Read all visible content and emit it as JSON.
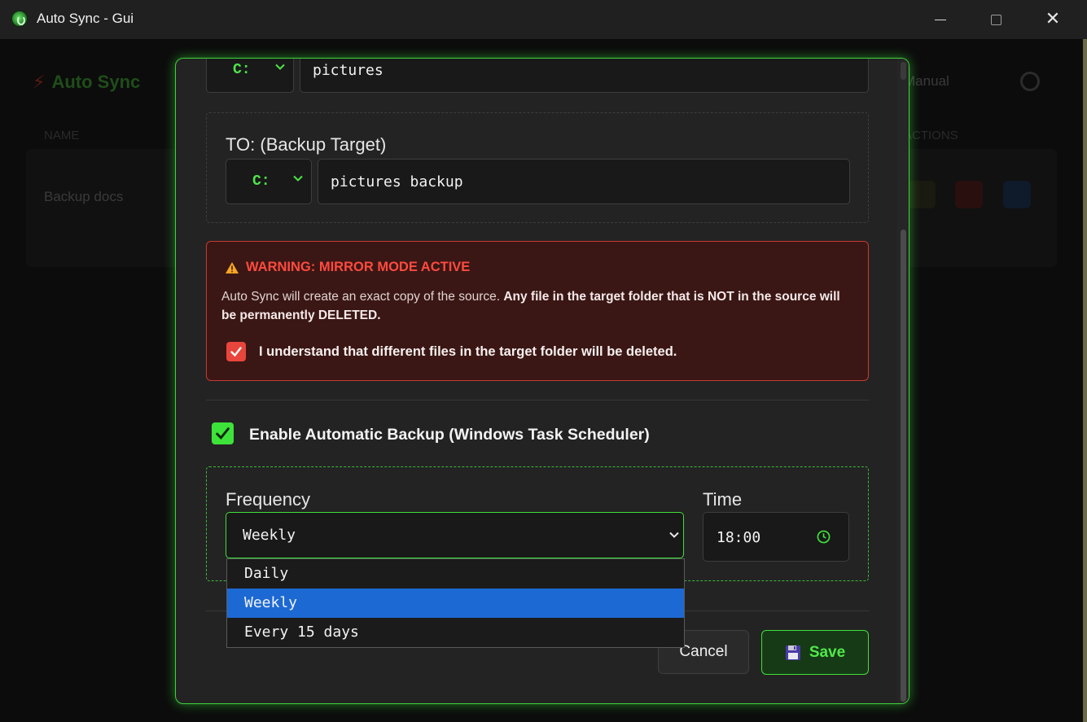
{
  "window": {
    "title": "Auto Sync - Gui"
  },
  "background": {
    "logo": "Auto Sync",
    "manual": "Manual",
    "column_name": "NAME",
    "column_actions": "ACTIONS",
    "row_name": "Backup docs"
  },
  "source": {
    "drive": "C:",
    "path": "pictures"
  },
  "target": {
    "label": "TO: (Backup Target)",
    "drive": "C:",
    "path": "pictures backup"
  },
  "warning": {
    "title": "WARNING: MIRROR MODE ACTIVE",
    "text_normal": "Auto Sync will create an exact copy of the source. ",
    "text_bold": "Any file in the target folder that is NOT in the source will be permanently DELETED.",
    "checkbox_label": "I understand that different files in the target folder will be deleted.",
    "checked": true
  },
  "schedule": {
    "enable_label": "Enable Automatic Backup (Windows Task Scheduler)",
    "enabled": true,
    "frequency_label": "Frequency",
    "frequency_value": "Weekly",
    "frequency_options": [
      "Daily",
      "Weekly",
      "Every 15 days"
    ],
    "selected_index": 1,
    "time_label": "Time",
    "time_value": "18:00"
  },
  "buttons": {
    "cancel": "Cancel",
    "save": "Save"
  },
  "colors": {
    "accent": "#3fe03a",
    "danger": "#ff4a3f",
    "highlight": "#1c69d4"
  }
}
